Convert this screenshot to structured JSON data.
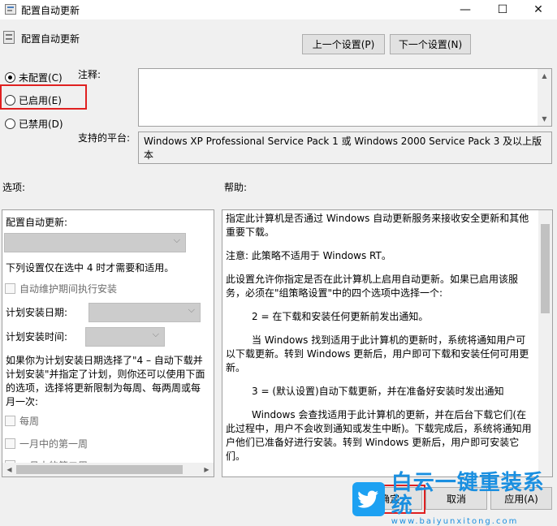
{
  "window": {
    "title": "配置自动更新",
    "minimize_glyph": "—",
    "maximize_glyph": "☐",
    "close_glyph": "✕"
  },
  "policy": {
    "name": "配置自动更新",
    "prev_button": "上一个设置(P)",
    "next_button": "下一个设置(N)"
  },
  "state_options": [
    {
      "label": "未配置(C)",
      "selected": true
    },
    {
      "label": "已启用(E)",
      "selected": false
    },
    {
      "label": "已禁用(D)",
      "selected": false
    }
  ],
  "comment": {
    "label": "注释:",
    "value": ""
  },
  "platform": {
    "label": "支持的平台:",
    "value": "Windows XP Professional Service Pack 1 或 Windows 2000 Service Pack 3 及以上版本"
  },
  "sections": {
    "options": "选项:",
    "help": "帮助:"
  },
  "options": {
    "configure_label": "配置自动更新:",
    "note_option4": "下列设置仅在选中 4 时才需要和适用。",
    "maintenance_checkbox": "自动维护期间执行安装",
    "schedule_day_label": "计划安装日期:",
    "schedule_time_label": "计划安装时间:",
    "schedule_paragraph": "如果你为计划安装日期选择了\"4 – 自动下载并计划安装\"并指定了计划，则你还可以使用下面的选项，选择将更新限制为每周、每两周或每月一次:",
    "weekly_checkbox": "每周",
    "first_week_checkbox": "一月中的第一周",
    "second_week_checkbox": "一月中的第二周"
  },
  "help": {
    "p1": "指定此计算机是否通过 Windows 自动更新服务来接收安全更新和其他重要下载。",
    "p2": "注意: 此策略不适用于 Windows RT。",
    "p3": "此设置允许你指定是否在此计算机上启用自动更新。如果已启用该服务，必须在\"组策略设置\"中的四个选项中选择一个:",
    "p4": "2 = 在下载和安装任何更新前发出通知。",
    "p5": "当 Windows 找到适用于此计算机的更新时，系统将通知用户可以下载更新。转到 Windows 更新后，用户即可下载和安装任何可用更新。",
    "p6": "3 = (默认设置)自动下载更新，并在准备好安装时发出通知",
    "p7": "Windows 会查找适用于此计算机的更新，并在后台下载它们(在此过程中，用户不会收到通知或发生中断)。下载完成后，系统将通知用户他们已准备好进行安装。转到 Windows 更新后，用户即可安装它们。"
  },
  "footer": {
    "ok": "确定",
    "cancel": "取消",
    "apply": "应用(A)"
  },
  "watermark": {
    "title": "白云一键重装系统",
    "url": "www.baiyunxitong.com",
    "badge_icon": "bird-icon"
  },
  "colors": {
    "highlight": "#e02020",
    "watermark": "#1a8fe0"
  }
}
